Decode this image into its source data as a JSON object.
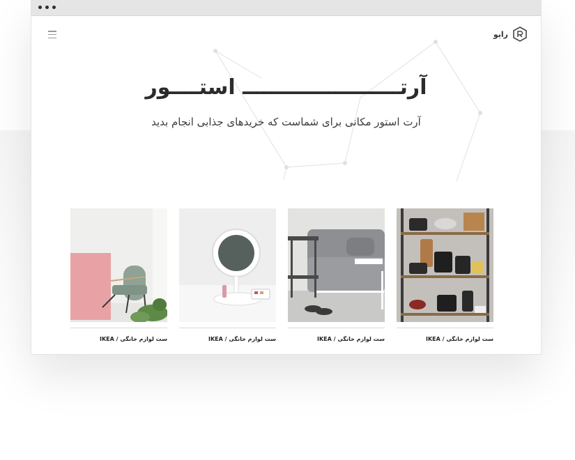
{
  "window": {
    "controls": [
      "close",
      "minimize",
      "maximize"
    ]
  },
  "header": {
    "logo_text": "رایو",
    "logo_icon": "r-hexagon-logo-icon",
    "menu_icon": "hamburger-menu-icon"
  },
  "hero": {
    "title": "آرتــــــــــــــــــــــ استــــور",
    "subtitle": "آرت استور مکانی برای شماست که خریدهای جذابی انجام بدید"
  },
  "products": [
    {
      "caption": "ست لوازم خانگی / IKEA",
      "image": "kitchen-shelf-with-cookware"
    },
    {
      "caption": "ست لوازم خانگی / IKEA",
      "image": "grey-sofa-bed-with-side-table"
    },
    {
      "caption": "ست لوازم خانگی / IKEA",
      "image": "vanity-mirror-with-makeup-tray"
    },
    {
      "caption": "ست لوازم خانگی / IKEA",
      "image": "armchair-with-pink-wall"
    }
  ]
}
